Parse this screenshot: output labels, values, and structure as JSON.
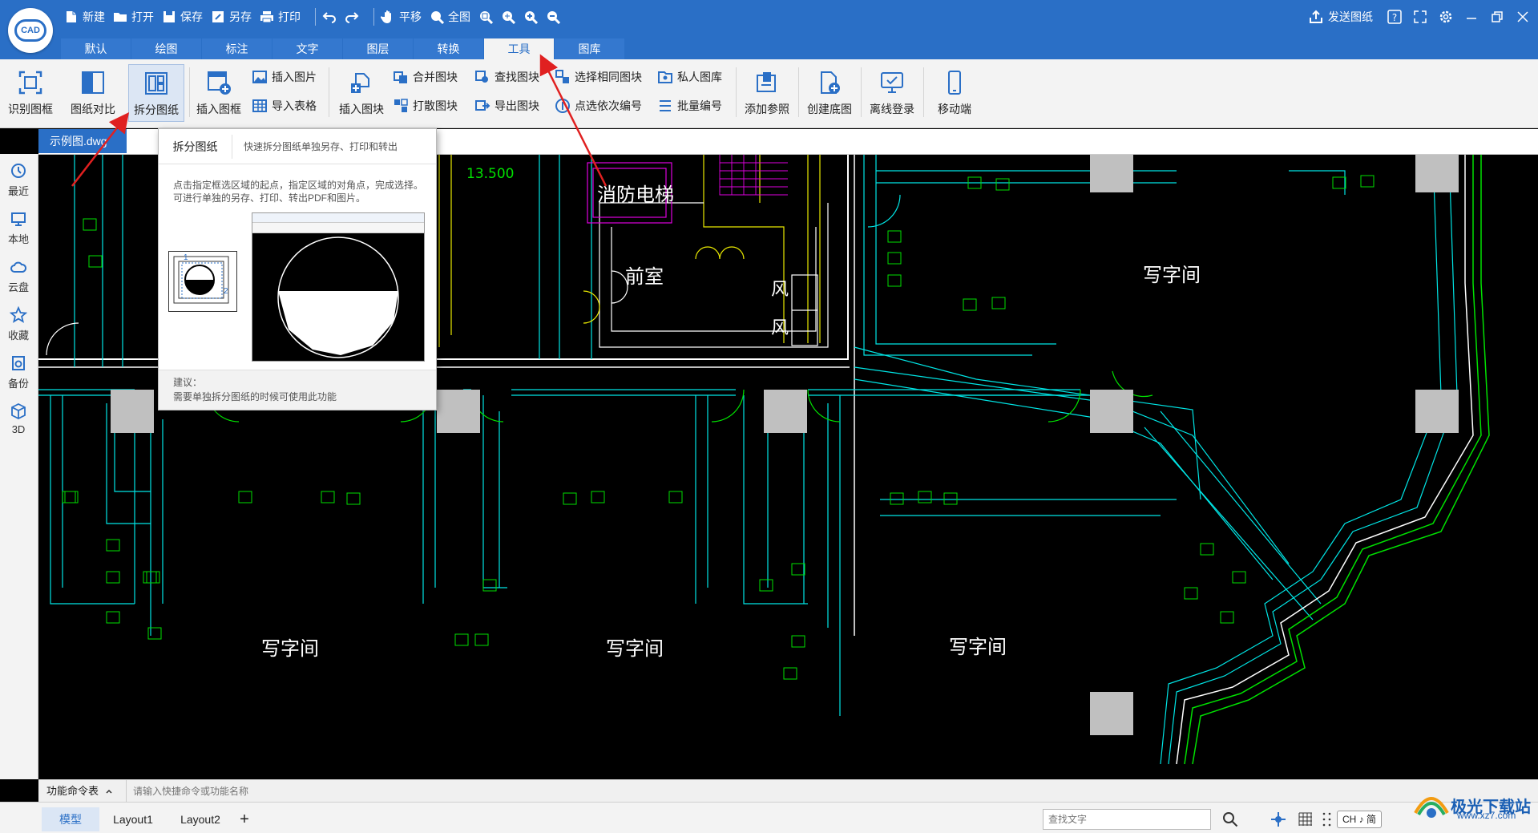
{
  "titlebar": {
    "quick": {
      "new": "新建",
      "open": "打开",
      "save": "保存",
      "save_as": "另存",
      "print": "打印",
      "pan": "平移",
      "fit": "全图"
    },
    "send_drawing": "发送图纸",
    "tabs": [
      "默认",
      "绘图",
      "标注",
      "文字",
      "图层",
      "转换",
      "工具",
      "图库"
    ],
    "active_tab": "工具"
  },
  "ribbon": {
    "recognize_frame": "识别图框",
    "compare": "图纸对比",
    "split": "拆分图纸",
    "insert_frame": "插入图框",
    "insert_image": "插入图片",
    "import_table": "导入表格",
    "insert_block": "插入图块",
    "merge_block": "合并图块",
    "explode_block": "打散图块",
    "find_block": "查找图块",
    "export_block": "导出图块",
    "select_same_block": "选择相同图块",
    "sequential_number": "点选依次编号",
    "private_library": "私人图库",
    "batch_number": "批量编号",
    "add_reference": "添加参照",
    "create_base": "创建底图",
    "offline_login": "离线登录",
    "mobile": "移动端"
  },
  "document": {
    "tab": "示例图.dwg"
  },
  "sidebar": {
    "items": [
      "最近",
      "本地",
      "云盘",
      "收藏",
      "备份",
      "3D"
    ]
  },
  "popup": {
    "title": "拆分图纸",
    "subtitle": "快速拆分图纸单独另存、打印和转出",
    "desc": "点击指定框选区域的起点，指定区域的对角点，完成选择。可进行单独的另存、打印、转出PDF和图片。",
    "footer_title": "建议：",
    "footer_text": "需要单独拆分图纸的时候可使用此功能",
    "mini_label1": "1",
    "mini_label2": "2"
  },
  "drawing": {
    "elevation": "13.500",
    "fire_elevator": "消防电梯",
    "lobby": "前室",
    "wind1": "风",
    "wind2": "风",
    "office_tr": "写字间",
    "office_b1": "写字间",
    "office_b2": "写字间",
    "office_b3": "写字间"
  },
  "cmdbar": {
    "label": "功能命令表",
    "placeholder": "请输入快捷命令或功能名称"
  },
  "statusbar": {
    "layouts": [
      "模型",
      "Layout1",
      "Layout2"
    ],
    "add": "+",
    "find_placeholder": "查找文字",
    "ime": "CH ♪ 简"
  },
  "watermark": {
    "text": "极光下载站",
    "url": "www.xz7.com"
  },
  "colors": {
    "brand": "#2a6fc6",
    "cad_cyan": "#00e5e5",
    "cad_green": "#00e000",
    "cad_yellow": "#e8e800",
    "cad_magenta": "#e000e0",
    "arrow_red": "#e02020"
  }
}
